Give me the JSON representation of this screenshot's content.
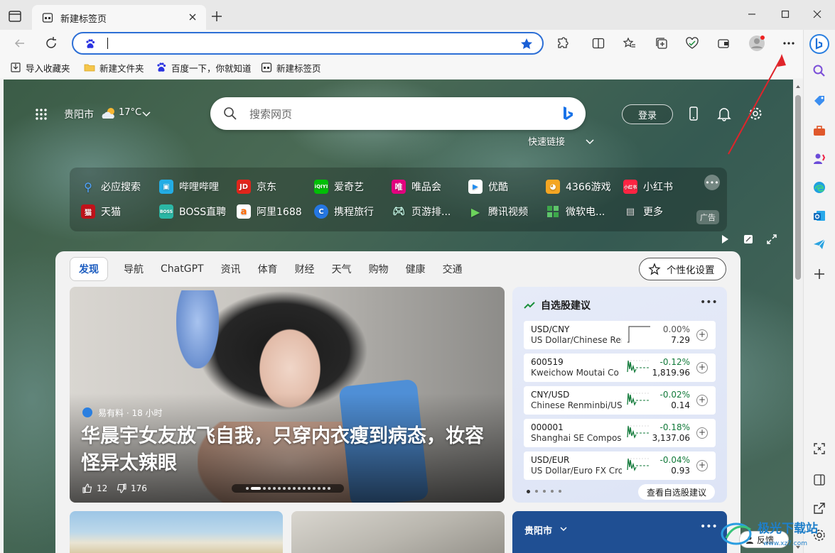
{
  "browser": {
    "tab_title": "新建标签页",
    "address_value": ""
  },
  "bookmarks": [
    {
      "label": "导入收藏夹",
      "icon": "import-icon"
    },
    {
      "label": "新建文件夹",
      "icon": "folder-icon"
    },
    {
      "label": "百度一下，你就知道",
      "icon": "baidu-icon"
    },
    {
      "label": "新建标签页",
      "icon": "newtab-icon"
    }
  ],
  "header": {
    "city": "贵阳市",
    "temperature": "17°C",
    "search_placeholder": "搜索网页",
    "quick_links_label": "快速链接",
    "login_label": "登录"
  },
  "quick_links": [
    {
      "label": "必应搜索",
      "color": "#2b6bd8",
      "glyph": "⚲"
    },
    {
      "label": "哔哩哔哩",
      "color": "#23ade5",
      "glyph": "▣"
    },
    {
      "label": "京东",
      "color": "#e1251b",
      "glyph": "JD"
    },
    {
      "label": "爱奇艺",
      "color": "#00be06",
      "glyph": "iQ"
    },
    {
      "label": "唯品会",
      "color": "#e4007f",
      "glyph": "唯"
    },
    {
      "label": "优酷",
      "color": "#1f8cf0",
      "glyph": "▶"
    },
    {
      "label": "4366游戏",
      "color": "#f5a623",
      "glyph": "◕"
    },
    {
      "label": "小红书",
      "color": "#ff2442",
      "glyph": "书"
    },
    {
      "label": "天猫",
      "color": "#c0121a",
      "glyph": "猫"
    },
    {
      "label": "BOSS直聘",
      "color": "#2bb7a5",
      "glyph": "B"
    },
    {
      "label": "阿里1688",
      "color": "#ff6a00",
      "glyph": "a"
    },
    {
      "label": "携程旅行",
      "color": "#2577e3",
      "glyph": "C"
    },
    {
      "label": "页游排...",
      "color": "#5aa84a",
      "glyph": "◎"
    },
    {
      "label": "腾讯视频",
      "color": "#1fb6ff",
      "glyph": "▶"
    },
    {
      "label": "微软电...",
      "color": "#3da84a",
      "glyph": "■"
    },
    {
      "label": "更多",
      "color": "#777777",
      "glyph": "▤"
    }
  ],
  "ad_badge": "广告",
  "feed": {
    "tabs": [
      "发现",
      "导航",
      "ChatGPT",
      "资讯",
      "体育",
      "财经",
      "天气",
      "购物",
      "健康",
      "交通"
    ],
    "personalize_label": "个性化设置",
    "hero": {
      "source": "易有料 · 18 小时",
      "headline": "华晨宇女友放飞自我，只穿内衣瘦到病态，妆容怪异太辣眼",
      "likes": "12",
      "dislikes": "176"
    },
    "stocks": {
      "title": "自选股建议",
      "rows": [
        {
          "symbol": "USD/CNY",
          "name": "US Dollar/Chinese Ren...",
          "change": "0.00%",
          "price": "7.29",
          "trend": "flat"
        },
        {
          "symbol": "600519",
          "name": "Kweichow Moutai Co ...",
          "change": "-0.12%",
          "price": "1,819.96",
          "trend": "down"
        },
        {
          "symbol": "CNY/USD",
          "name": "Chinese Renminbi/US ...",
          "change": "-0.02%",
          "price": "0.14",
          "trend": "down"
        },
        {
          "symbol": "000001",
          "name": "Shanghai SE Composit...",
          "change": "-0.18%",
          "price": "3,137.06",
          "trend": "down"
        },
        {
          "symbol": "USD/EUR",
          "name": "US Dollar/Euro FX Cro...",
          "change": "-0.04%",
          "price": "0.93",
          "trend": "down"
        }
      ],
      "view_all": "查看自选股建议",
      "colors": {
        "flat": "#555555",
        "down": "#127a3a"
      }
    },
    "city_card": "贵阳市"
  },
  "feedback_label": "反馈",
  "watermark_text": "极光下载站"
}
